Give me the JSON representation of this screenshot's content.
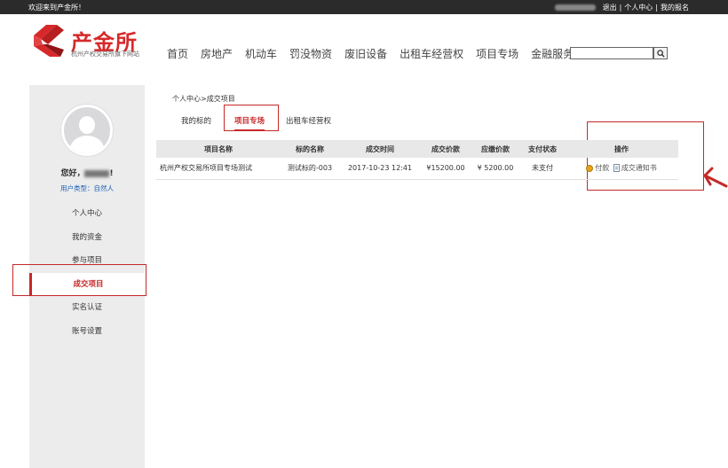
{
  "topbar": {
    "welcome": "欢迎来到产金所！",
    "logout": "退出",
    "user_center": "个人中心",
    "my_signup": "我的报名",
    "separator": "|"
  },
  "logo": {
    "name": "产金所",
    "subtitle": "杭州产权交易所旗下网站",
    "brand_color": "#d7282a"
  },
  "nav": {
    "items": [
      "首页",
      "房地产",
      "机动车",
      "罚没物资",
      "废旧设备",
      "出租车经营权",
      "项目专场",
      "金融服务"
    ]
  },
  "search": {
    "placeholder": "",
    "icon": "search-icon"
  },
  "sidebar": {
    "greeting": "您好，",
    "user_type_label": "用户类型：",
    "user_type_value": "自然人",
    "items": [
      "个人中心",
      "我的资金",
      "参与项目",
      "成交项目",
      "实名认证",
      "账号设置"
    ],
    "active_index": 3
  },
  "breadcrumb": "个人中心>成交项目",
  "tabs": {
    "items": [
      "我的标的",
      "项目专场",
      "出租车经营权"
    ],
    "active_index": 1
  },
  "table": {
    "headers": [
      "项目名称",
      "标的名称",
      "成交时间",
      "成交价款",
      "应缴价款",
      "支付状态",
      "操作"
    ],
    "rows": [
      {
        "project": "杭州产权交易所项目专场测试",
        "subject": "测试标的-003",
        "time": "2017-10-23 12:41",
        "deal_price": "¥15200.00",
        "due_price": "¥ 5200.00",
        "status": "未支付",
        "op_pay": "付款",
        "op_notice": "成交通知书"
      }
    ]
  },
  "colors": {
    "highlight_red": "#c62828",
    "unpaid_red": "#d62a2a",
    "topbar_bg": "#2b2b2b",
    "sidebar_bg": "#ececec"
  }
}
